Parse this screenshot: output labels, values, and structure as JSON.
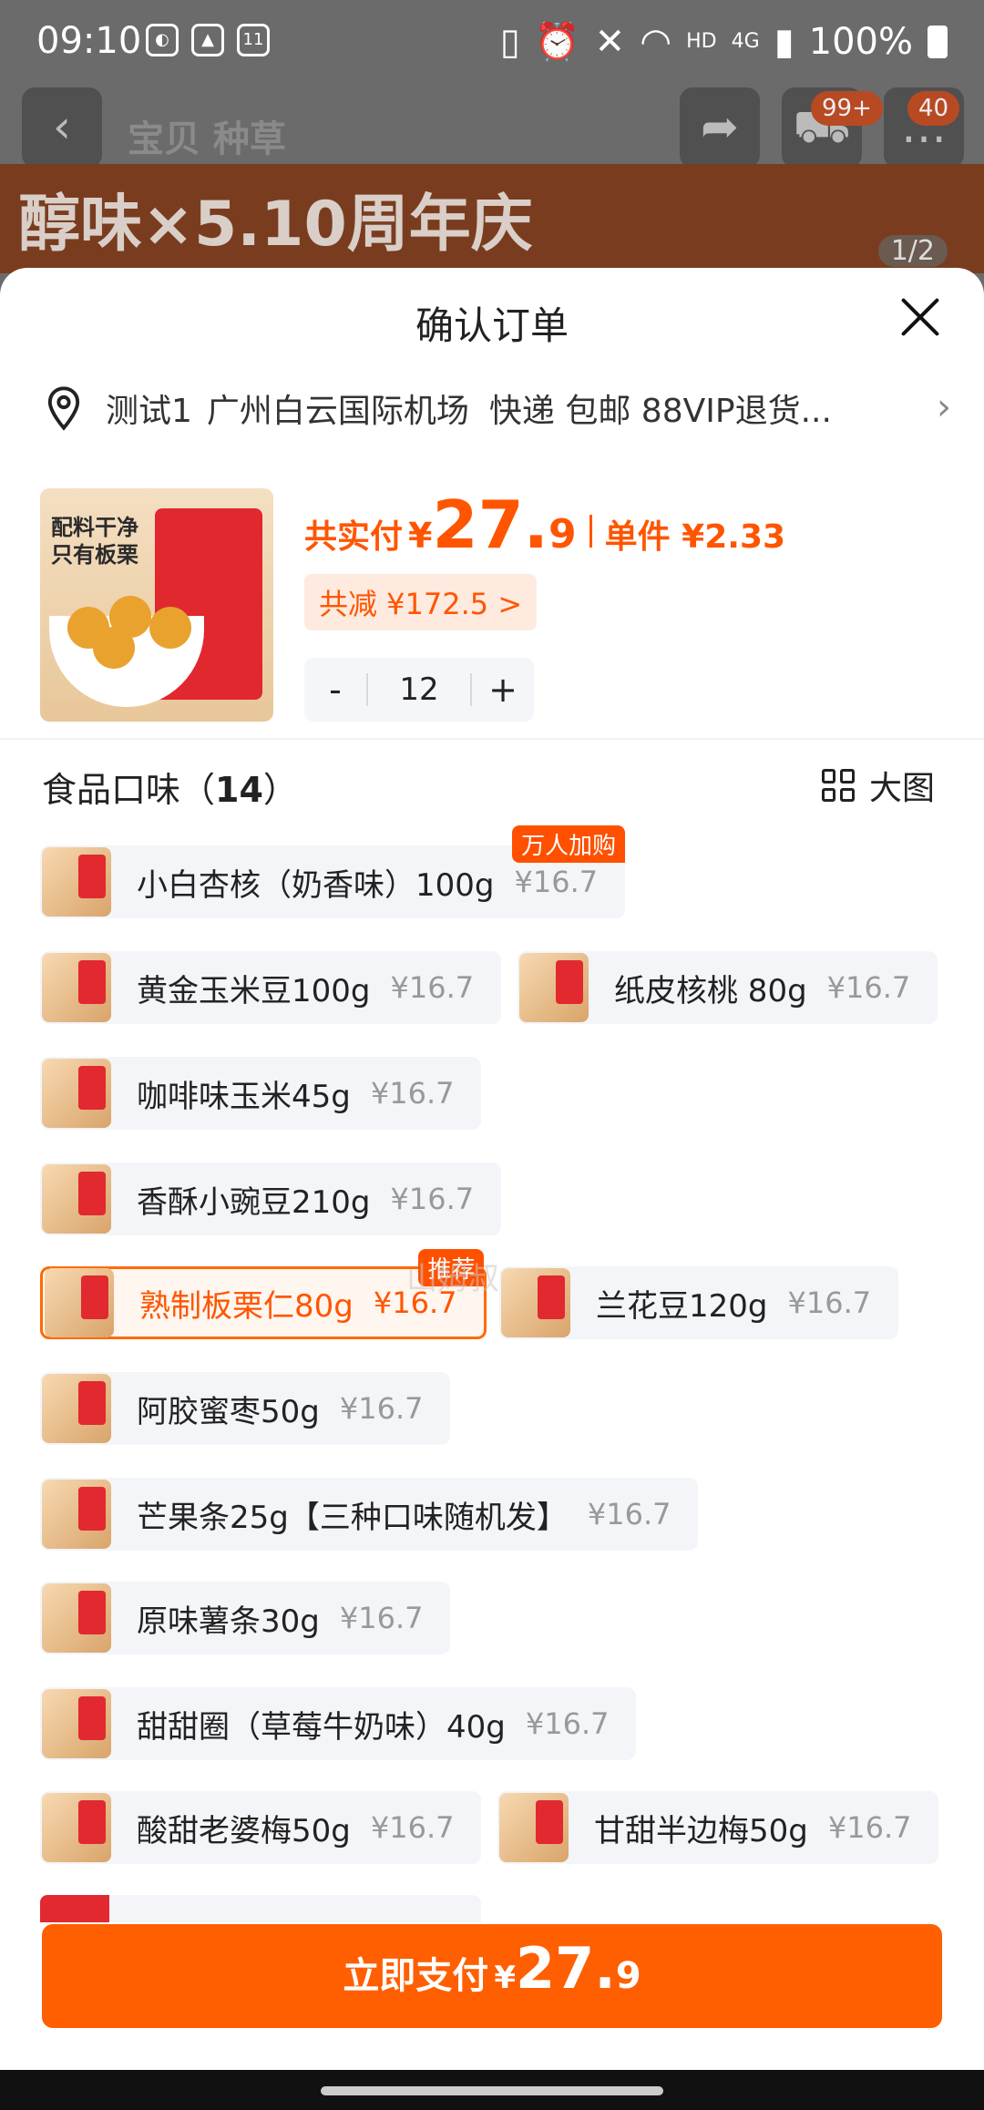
{
  "status_bar": {
    "time": "09:10",
    "net_label": "HD",
    "net_type": "4G",
    "battery": "100%"
  },
  "background": {
    "tabs": "宝贝  种草",
    "cart_badge": "99+",
    "msg_badge": "40",
    "banner_text": "醇味×5.10周年庆",
    "banner_page": "1/2"
  },
  "sheet": {
    "title": "确认订单",
    "address": {
      "name": "测试1",
      "place": "广州白云国际机场",
      "extra": "快递 包邮 88VIP退货..."
    },
    "price": {
      "label": "共实付",
      "yen": "¥",
      "int": "27.",
      "dec": "9",
      "unit": "单件 ¥2.33"
    },
    "saving": "共减 ¥172.5 >",
    "qty": {
      "minus": "-",
      "value": "12",
      "plus": "+"
    },
    "section": {
      "title_prefix": "食品口味（",
      "count": "14",
      "title_suffix": "）",
      "bigview": "大图"
    },
    "product_image_text": "配料干净\n只有板栗",
    "watermark": "山姆叔",
    "options": [
      {
        "name": "小白杏核（奶香味）100g",
        "price": "¥16.7",
        "tag": "万人加购"
      },
      {
        "name": "黄金玉米豆100g",
        "price": "¥16.7",
        "tag": ""
      },
      {
        "name": "纸皮核桃 80g",
        "price": "¥16.7",
        "tag": ""
      },
      {
        "name": "咖啡味玉米45g",
        "price": "¥16.7",
        "tag": ""
      },
      {
        "name": "香酥小豌豆210g",
        "price": "¥16.7",
        "tag": ""
      },
      {
        "name": "熟制板栗仁80g",
        "price": "¥16.7",
        "tag": "推荐"
      },
      {
        "name": "兰花豆120g",
        "price": "¥16.7",
        "tag": ""
      },
      {
        "name": "阿胶蜜枣50g",
        "price": "¥16.7",
        "tag": ""
      },
      {
        "name": "芒果条25g【三种口味随机发】",
        "price": "¥16.7",
        "tag": ""
      },
      {
        "name": "原味薯条30g",
        "price": "¥16.7",
        "tag": ""
      },
      {
        "name": "甜甜圈（草莓牛奶味）40g",
        "price": "¥16.7",
        "tag": ""
      },
      {
        "name": "酸甜老婆梅50g",
        "price": "¥16.7",
        "tag": ""
      },
      {
        "name": "甘甜半边梅50g",
        "price": "¥16.7",
        "tag": ""
      }
    ],
    "selected_option": "熟制板栗仁80g",
    "pay": {
      "label": "立即支付",
      "yen": "¥",
      "int": "27.",
      "dec": "9"
    }
  },
  "colors": {
    "accent": "#ff5500",
    "pay_button": "#ff5f00",
    "chip_bg": "#f3f5f8"
  }
}
